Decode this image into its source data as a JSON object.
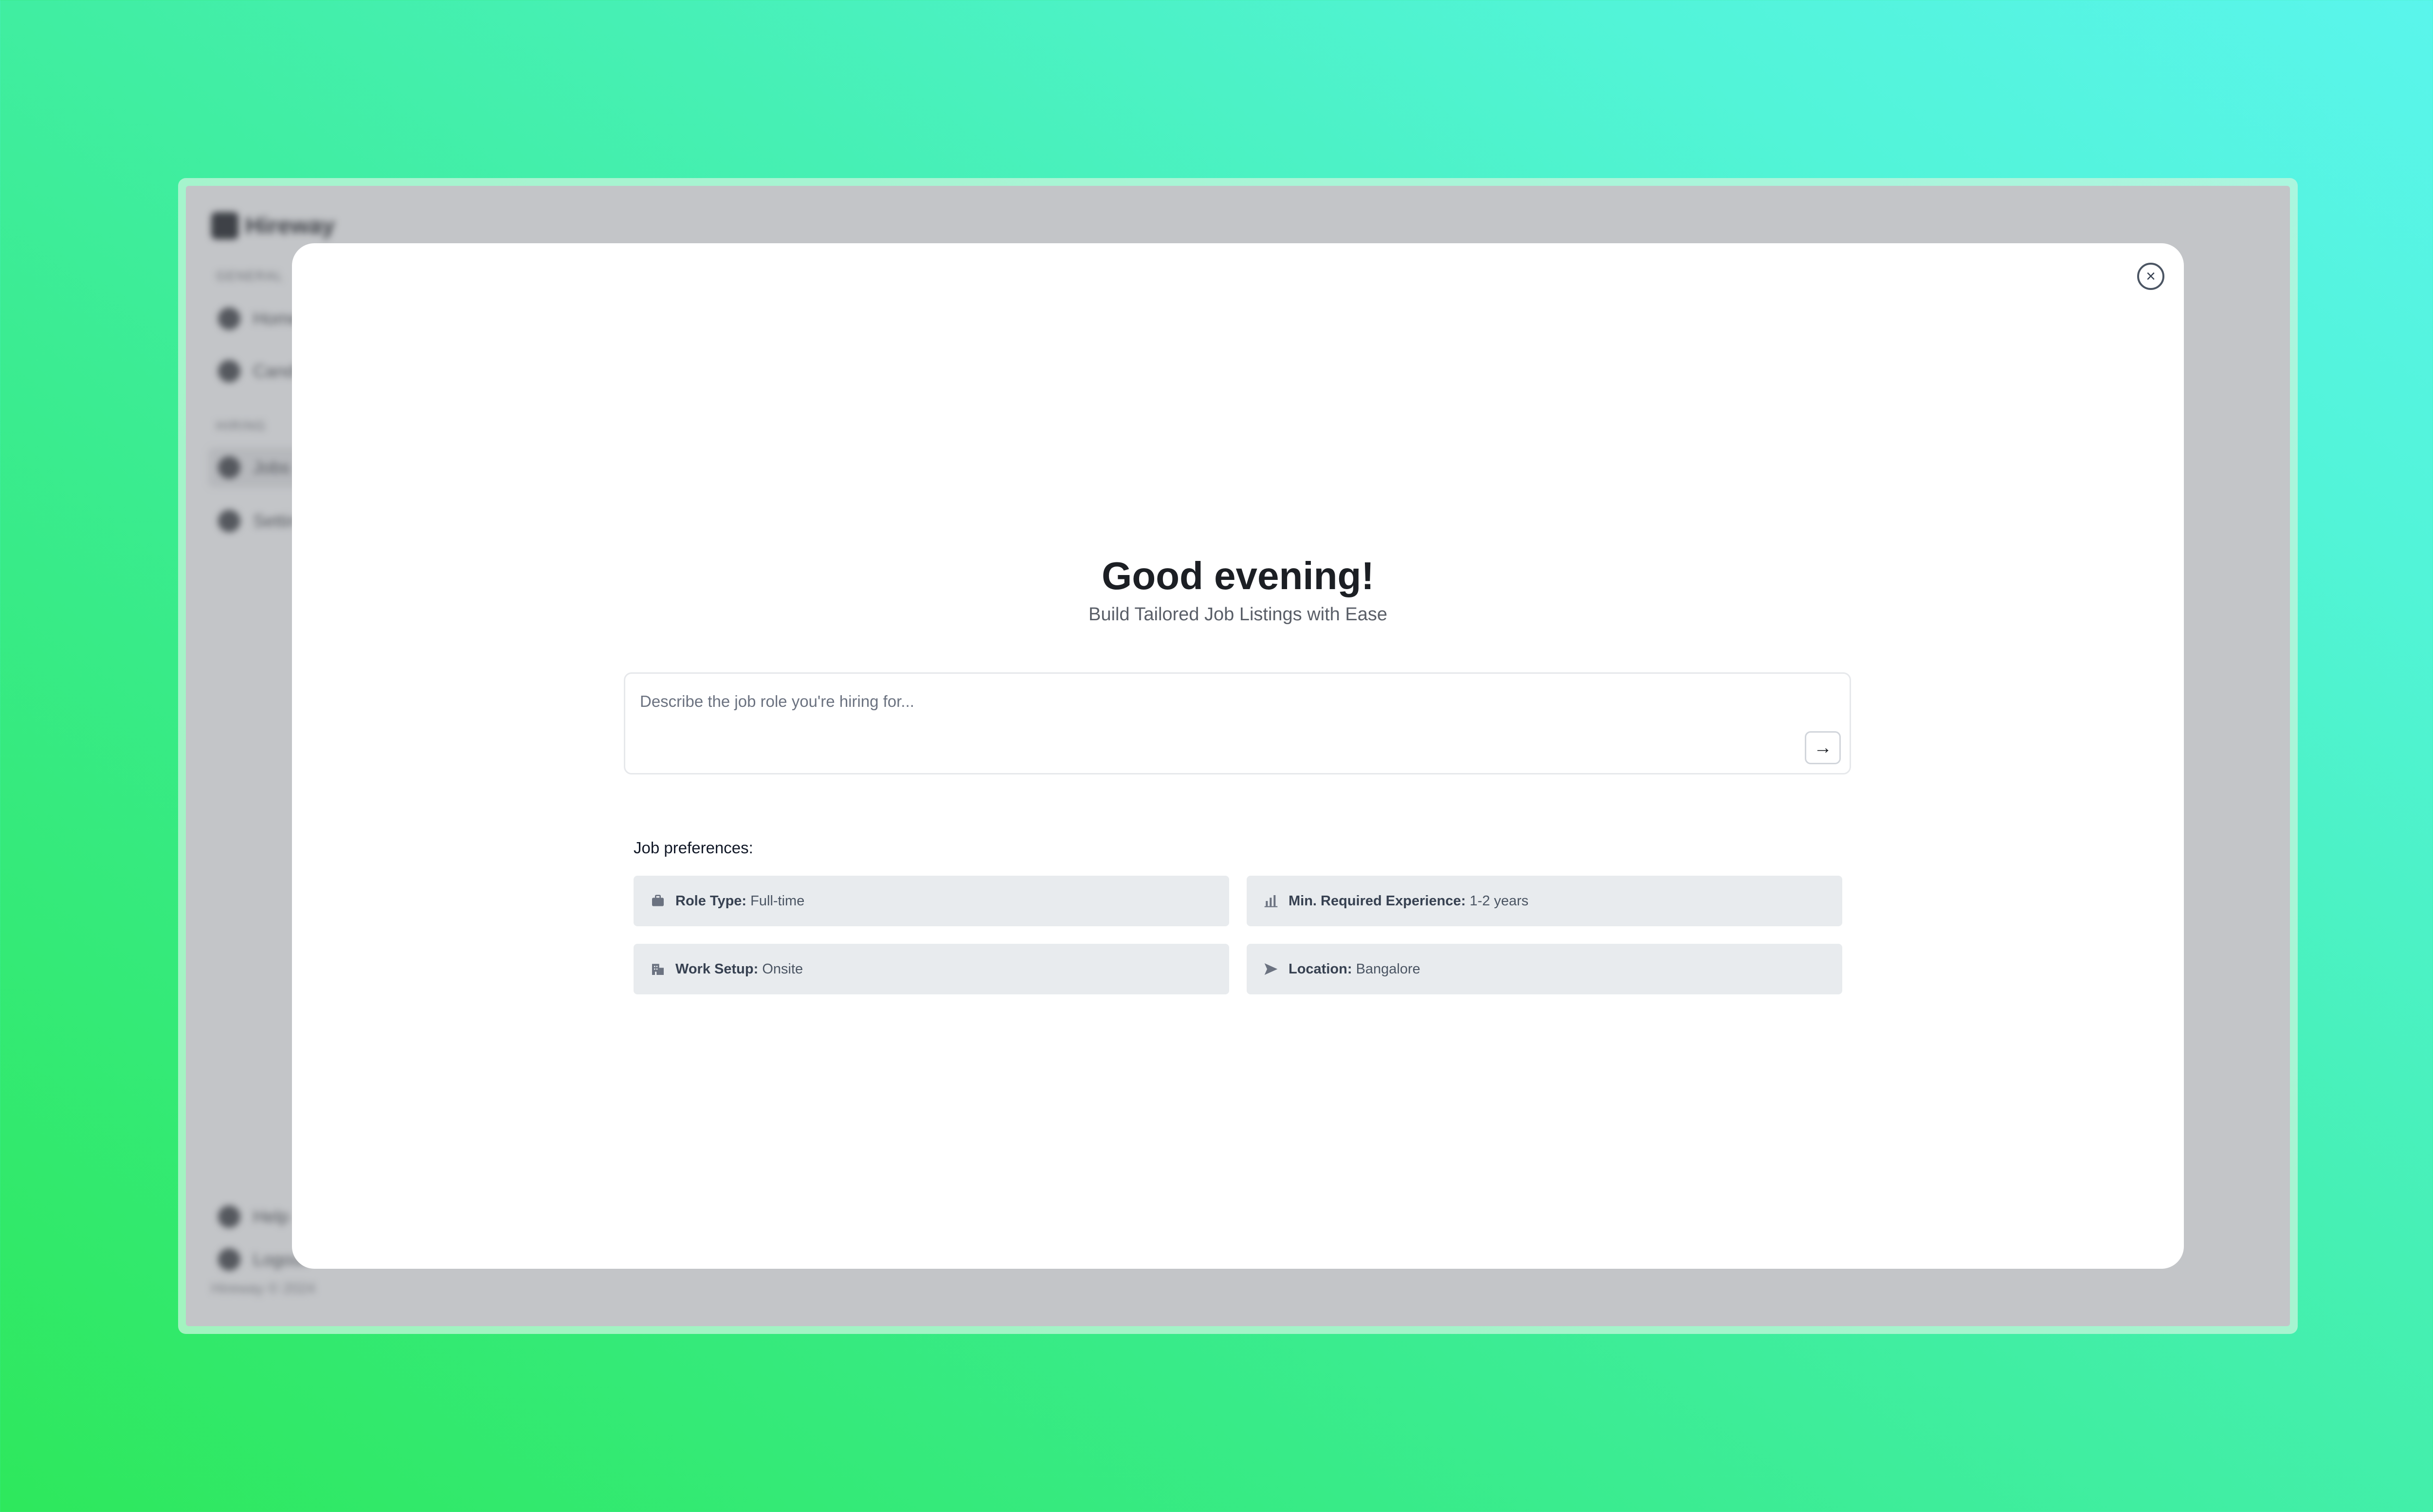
{
  "app": {
    "brand": "Hireway"
  },
  "sidebar": {
    "group1_label": "GENERAL",
    "group2_label": "HIRING",
    "items": [
      {
        "label": "Home"
      },
      {
        "label": "Candidates"
      },
      {
        "label": "Jobs"
      },
      {
        "label": "Settings"
      },
      {
        "label": "Help"
      },
      {
        "label": "Logout"
      }
    ],
    "footer": "Hireway © 2024"
  },
  "modal": {
    "close_symbol": "×",
    "greeting": "Good evening!",
    "subtitle": "Build Tailored Job Listings with Ease",
    "prompt": {
      "placeholder": "Describe the job role you're hiring for...",
      "value": "",
      "send_symbol": "→"
    },
    "preferences": {
      "title": "Job preferences:",
      "items": [
        {
          "key": "Role Type:",
          "value": "Full-time",
          "icon": "briefcase-icon"
        },
        {
          "key": "Min. Required Experience:",
          "value": "1-2 years",
          "icon": "bar-chart-icon"
        },
        {
          "key": "Work Setup:",
          "value": "Onsite",
          "icon": "building-icon"
        },
        {
          "key": "Location:",
          "value": "Bangalore",
          "icon": "navigation-arrow-icon"
        }
      ]
    }
  },
  "colors": {
    "background_gradient_start": "#2ee85c",
    "background_gradient_end": "#5af5ec",
    "overlay": "#c3c5c8",
    "preference_chip": "#e8ebee",
    "heading": "#1c1f24"
  }
}
